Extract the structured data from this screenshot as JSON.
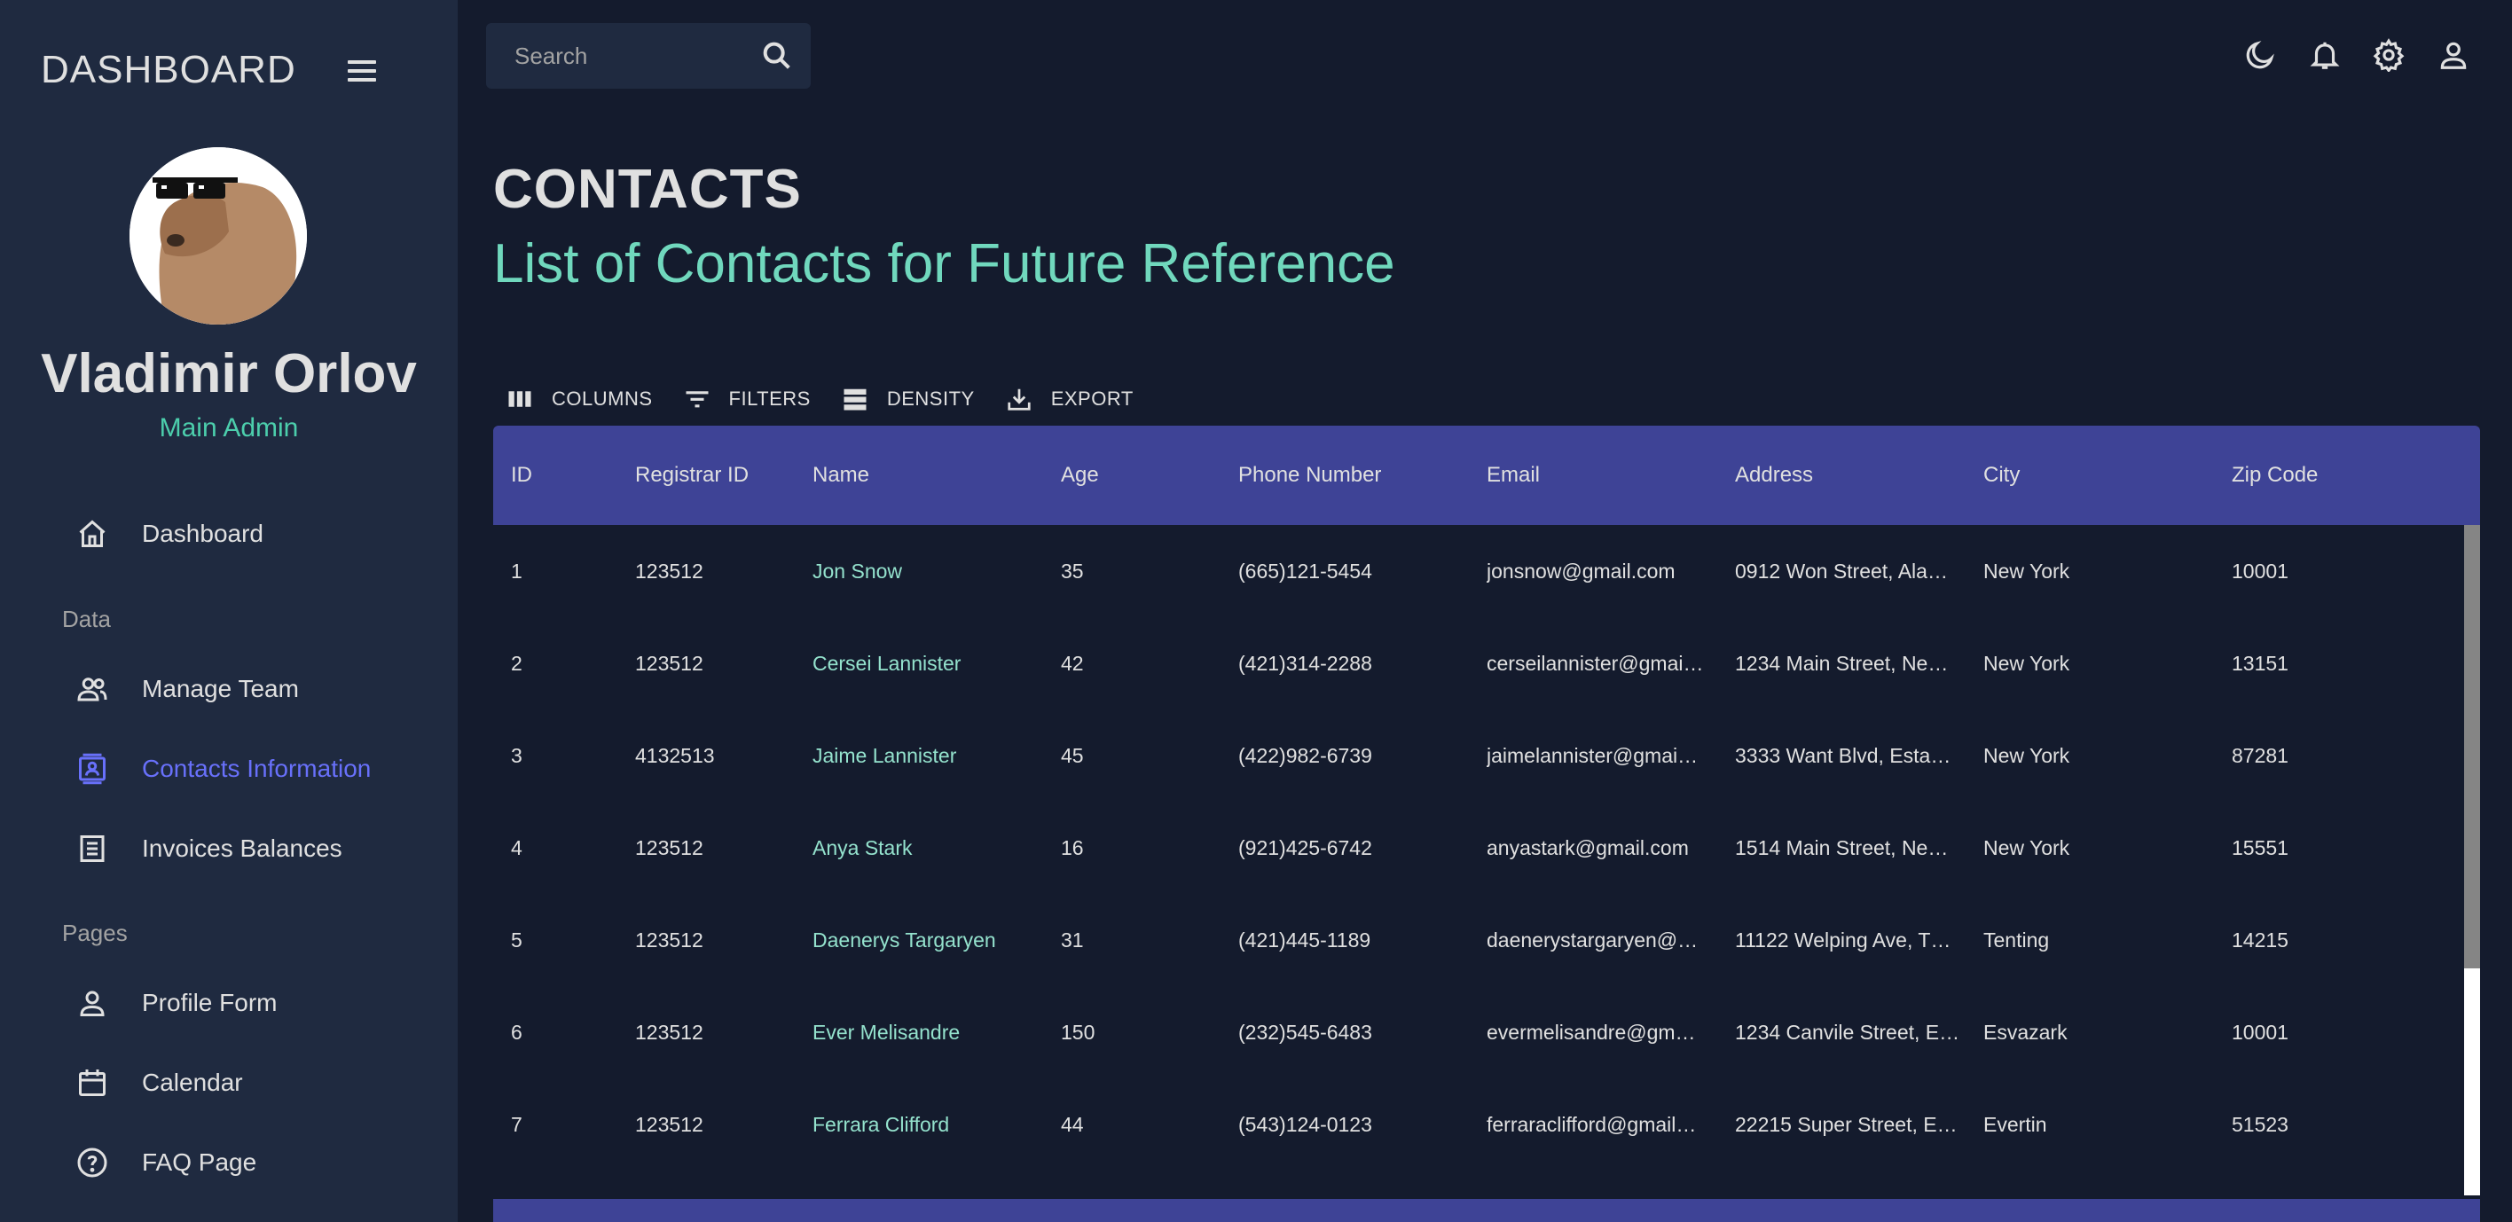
{
  "sidebar": {
    "brand": "DASHBOARD",
    "user": {
      "name": "Vladimir Orlov",
      "role": "Main Admin"
    },
    "items": [
      {
        "label": "Dashboard",
        "icon": "home-icon"
      },
      {
        "label": "Manage Team",
        "icon": "people-icon"
      },
      {
        "label": "Contacts Information",
        "icon": "contacts-icon",
        "active": true
      },
      {
        "label": "Invoices Balances",
        "icon": "receipt-icon"
      },
      {
        "label": "Profile Form",
        "icon": "person-icon"
      },
      {
        "label": "Calendar",
        "icon": "calendar-icon"
      },
      {
        "label": "FAQ Page",
        "icon": "help-icon"
      }
    ],
    "sections": {
      "data": "Data",
      "pages": "Pages"
    }
  },
  "topbar": {
    "search": {
      "placeholder": "Search",
      "value": ""
    },
    "icons": [
      "dark-mode-icon",
      "notifications-icon",
      "settings-icon",
      "account-icon"
    ]
  },
  "header": {
    "title": "CONTACTS",
    "subtitle": "List of Contacts for Future Reference"
  },
  "toolbar": {
    "columns": "COLUMNS",
    "filters": "FILTERS",
    "density": "DENSITY",
    "export": "EXPORT"
  },
  "table": {
    "columns": [
      "ID",
      "Registrar ID",
      "Name",
      "Age",
      "Phone Number",
      "Email",
      "Address",
      "City",
      "Zip Code"
    ],
    "rows": [
      [
        "1",
        "123512",
        "Jon Snow",
        "35",
        "(665)121-5454",
        "jonsnow@gmail.com",
        "0912 Won Street, Ala…",
        "New York",
        "10001"
      ],
      [
        "2",
        "123512",
        "Cersei Lannister",
        "42",
        "(421)314-2288",
        "cerseilannister@gmai…",
        "1234 Main Street, Ne…",
        "New York",
        "13151"
      ],
      [
        "3",
        "4132513",
        "Jaime Lannister",
        "45",
        "(422)982-6739",
        "jaimelannister@gmai…",
        "3333 Want Blvd, Esta…",
        "New York",
        "87281"
      ],
      [
        "4",
        "123512",
        "Anya Stark",
        "16",
        "(921)425-6742",
        "anyastark@gmail.com",
        "1514 Main Street, Ne…",
        "New York",
        "15551"
      ],
      [
        "5",
        "123512",
        "Daenerys Targaryen",
        "31",
        "(421)445-1189",
        "daenerystargaryen@…",
        "11122 Welping Ave, T…",
        "Tenting",
        "14215"
      ],
      [
        "6",
        "123512",
        "Ever Melisandre",
        "150",
        "(232)545-6483",
        "evermelisandre@gm…",
        "1234 Canvile Street, E…",
        "Esvazark",
        "10001"
      ],
      [
        "7",
        "123512",
        "Ferrara Clifford",
        "44",
        "(543)124-0123",
        "ferraraclifford@gmail…",
        "22215 Super Street, E…",
        "Evertin",
        "51523"
      ]
    ]
  },
  "colors": {
    "background": "#141b2d",
    "sidebar": "#1f2a40",
    "table_header": "#3e4396",
    "accent_green": "#70d8bd",
    "accent_active": "#6870fa"
  }
}
